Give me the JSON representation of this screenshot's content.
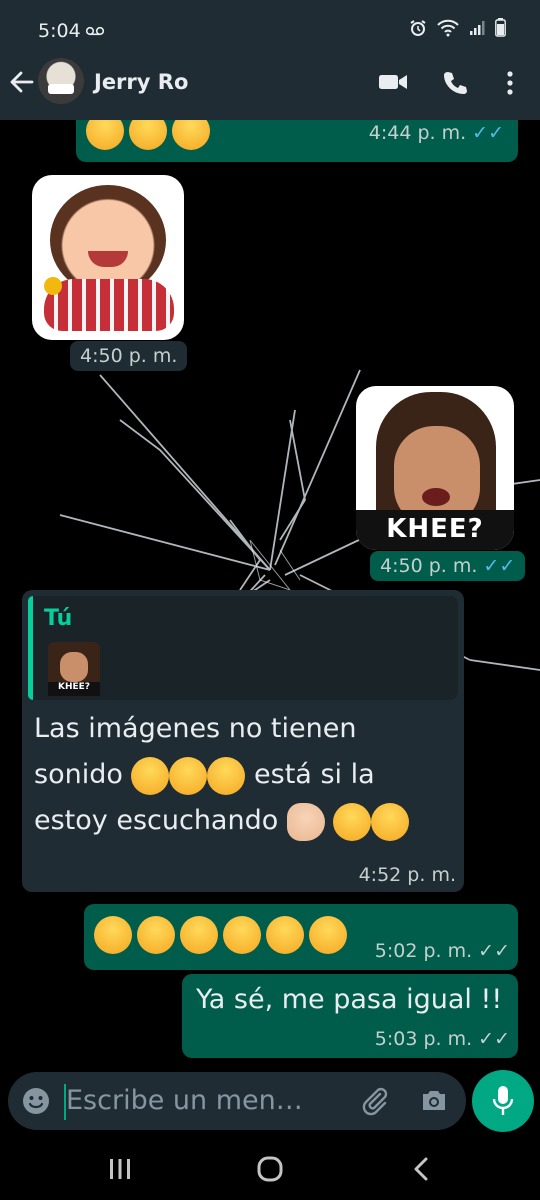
{
  "status_bar": {
    "time": "5:04",
    "voicemail_icon": "voicemail-icon",
    "icons": [
      "alarm-icon",
      "wifi-icon",
      "signal-icon",
      "battery-icon"
    ]
  },
  "header": {
    "contact_name": "Jerry Ro",
    "icons": [
      "back-arrow-icon",
      "video-call-icon",
      "phone-icon",
      "more-vert-icon"
    ]
  },
  "messages": [
    {
      "id": "m1",
      "direction": "out",
      "type": "emoji",
      "emoji": "kissing-face-with-heart",
      "count": 3,
      "time": "4:44 p. m.",
      "status": "read"
    },
    {
      "id": "m2",
      "direction": "in",
      "type": "sticker",
      "sticker": "smiling-girl-with-lollipop",
      "time": "4:50 p. m."
    },
    {
      "id": "m3",
      "direction": "out",
      "type": "sticker",
      "sticker": "man-khee",
      "sticker_text": "KHEE?",
      "time": "4:50 p. m.",
      "status": "read"
    },
    {
      "id": "m4",
      "direction": "in",
      "type": "reply",
      "quoted_author": "Tú",
      "quoted_sticker_text": "KHEE?",
      "text_line1": "Las imágenes no tienen",
      "text_line2_before": "sonido",
      "text_line2_after": "está si la",
      "text_line3": "estoy escuchando",
      "time": "4:52 p. m."
    },
    {
      "id": "m5",
      "direction": "out",
      "type": "emoji",
      "emoji": "rolling-on-floor-laughing",
      "count": 6,
      "time": "5:02 p. m.",
      "status": "delivered"
    },
    {
      "id": "m6",
      "direction": "out",
      "type": "text",
      "text": "Ya sé, me pasa igual !!",
      "time": "5:03 p. m.",
      "status": "delivered"
    }
  ],
  "composer": {
    "placeholder": "Escribe un men…",
    "icons": [
      "emoji-icon",
      "attach-icon",
      "camera-icon",
      "mic-icon"
    ]
  },
  "navbar": {
    "icons": [
      "recent-apps-icon",
      "home-icon",
      "back-icon"
    ]
  },
  "colors": {
    "outgoing": "#005c4b",
    "incoming": "#202c33",
    "header": "#1f2c34",
    "accent": "#00a884",
    "read_ticks": "#53bdeb"
  }
}
